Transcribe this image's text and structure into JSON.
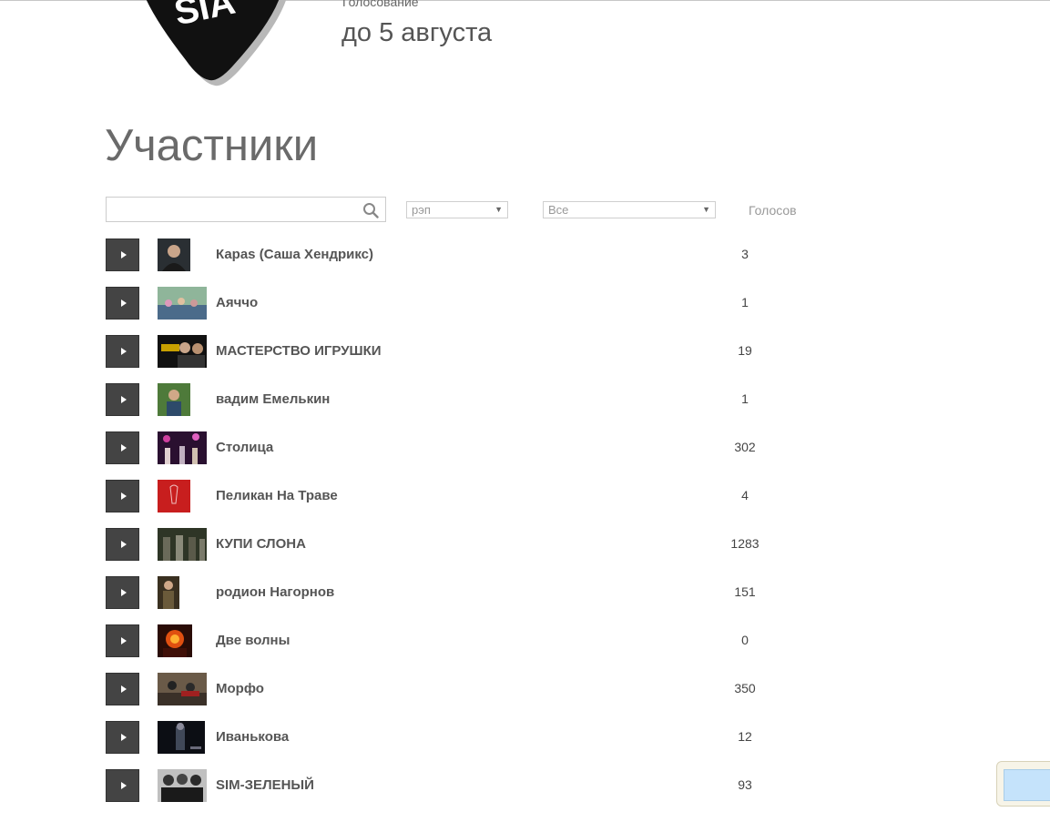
{
  "header": {
    "logo_text": "SIA",
    "voting_caption": "Голосование",
    "voting_date": "до 5 августа"
  },
  "main": {
    "title": "Участники",
    "search": {
      "value": "",
      "placeholder": ""
    },
    "genre_filter": {
      "selected": "рэп"
    },
    "scope_filter": {
      "selected": "Все"
    },
    "votes_header": "Голосов"
  },
  "participants": [
    {
      "name": "Карas (Саша Хендрикс)",
      "votes": "3",
      "thumb_icon": "portrait-photo"
    },
    {
      "name": "Аяччо",
      "votes": "1",
      "thumb_icon": "group-photo"
    },
    {
      "name": "МАСТЕРСТВО ИГРУШКИ",
      "votes": "19",
      "thumb_icon": "group-photo"
    },
    {
      "name": "вадим Емелькин",
      "votes": "1",
      "thumb_icon": "portrait-photo"
    },
    {
      "name": "Столица",
      "votes": "302",
      "thumb_icon": "concert-photo"
    },
    {
      "name": "Пеликан На Траве",
      "votes": "4",
      "thumb_icon": "album-cover"
    },
    {
      "name": "КУПИ СЛОНА",
      "votes": "1283",
      "thumb_icon": "group-photo"
    },
    {
      "name": "родион Нагорнов",
      "votes": "151",
      "thumb_icon": "portrait-photo"
    },
    {
      "name": "Две волны",
      "votes": "0",
      "thumb_icon": "concert-photo"
    },
    {
      "name": "Морфо",
      "votes": "350",
      "thumb_icon": "group-photo"
    },
    {
      "name": "Иванькова",
      "votes": "12",
      "thumb_icon": "portrait-photo"
    },
    {
      "name": "SIM-ЗЕЛЕНЫЙ",
      "votes": "93",
      "thumb_icon": "group-photo"
    }
  ],
  "colors": {
    "play_button": "#444444",
    "title_text": "#6a6a6a",
    "widget_fill": "#c5e3fb"
  }
}
